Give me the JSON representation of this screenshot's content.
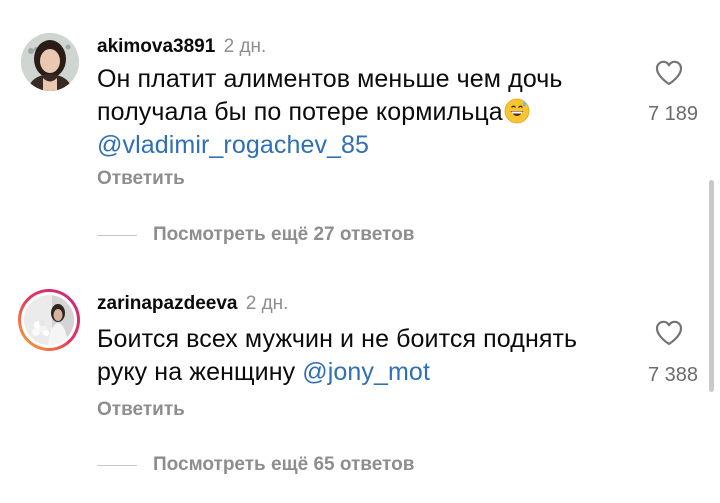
{
  "comments": [
    {
      "username": "akimova3891",
      "time": "2 дн.",
      "text_line1": "Он платит алиментов меньше чем дочь",
      "text_line2": "получала бы по потере кормильца",
      "emoji": "grinning-face-with-sweat",
      "mention": "@vladimir_rogachev_85",
      "reply_label": "Ответить",
      "likes": "7 189",
      "view_replies": "Посмотреть ещё 27 ответов"
    },
    {
      "username": "zarinapazdeeva",
      "time": "2 дн.",
      "text_line1": "Боится всех мужчин и не боится поднять",
      "text_line2": "руку на женщину",
      "mention": "@jony_mot",
      "reply_label": "Ответить",
      "likes": "7 388",
      "view_replies": "Посмотреть ещё 65 ответов"
    }
  ],
  "colors": {
    "mention": "#2f6fb7",
    "secondary_text": "#8e8e8e",
    "story_ring_start": "#f9b233",
    "story_ring_end": "#c0278b"
  },
  "icons": {
    "like": "heart-outline-icon"
  }
}
